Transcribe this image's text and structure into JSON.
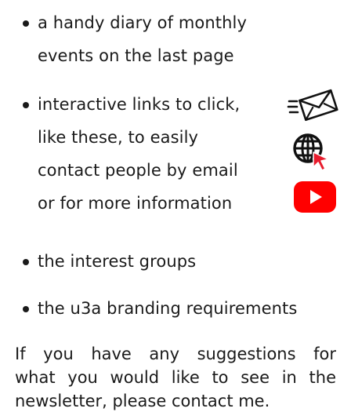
{
  "bullets": [
    {
      "lines": [
        "a handy diary of monthly",
        "events on the last page"
      ]
    },
    {
      "lines": [
        "interactive links to click,",
        "like these, to easily",
        "contact people by email",
        "or for more information"
      ]
    },
    {
      "lines": [
        "the interest groups"
      ]
    },
    {
      "lines": [
        "the u3a branding requirements"
      ]
    }
  ],
  "paragraph": {
    "lines": [
      "If you have any suggestions for",
      "what you would like to see in the",
      "newsletter, please contact me."
    ]
  },
  "icons": {
    "email": "email-envelope-icon",
    "web": "globe-with-cursor-icon",
    "youtube": "youtube-play-icon"
  },
  "colors": {
    "text": "#1a1a1a",
    "youtube_red": "#ff0000",
    "cursor_red": "#e81c2d"
  }
}
